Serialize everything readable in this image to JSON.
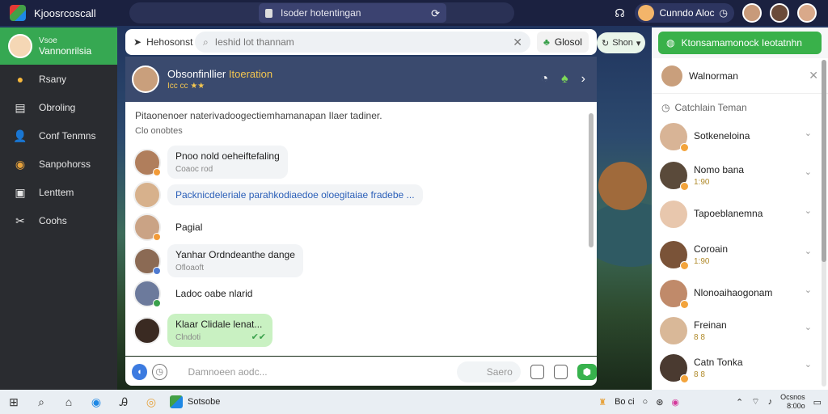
{
  "app": {
    "title": "Kjoosrcoscall"
  },
  "topbar": {
    "address": "Isoder hotentingan",
    "user_name": "Cunndo Aloc"
  },
  "sidebar": {
    "profile_small": "Vsoe",
    "profile_name": "Vannonrilsia",
    "items": [
      {
        "label": "Rsany",
        "icon": "sun-icon"
      },
      {
        "label": "Obroling",
        "icon": "list-icon"
      },
      {
        "label": "Conf Tenmns",
        "icon": "person-icon"
      },
      {
        "label": "Sanpohorss",
        "icon": "chrome-icon"
      },
      {
        "label": "Lenttem",
        "icon": "window-icon"
      },
      {
        "label": "Coohs",
        "icon": "tools-icon"
      }
    ]
  },
  "main_top": {
    "contact": "Hehosonst",
    "search_placeholder": "Ieshid lot thannam",
    "action": "Glosol",
    "filter": "Shon"
  },
  "chat_header": {
    "title_a": "Obsonfinllier",
    "title_b": "Itoeration",
    "subtitle": "Icc cc"
  },
  "chat": {
    "notice": "Pitaonenoer naterivadoogectiemhamanapan Ilaer tadiner.",
    "notice_sub": "Clo onobtes",
    "messages": [
      {
        "text": "Pnoo nold oeheiftefaling",
        "time": "Coaoc rod"
      },
      {
        "text": "Packnicdeleriale parahkodiaedoe oloegitaiae fradebe ..."
      },
      {
        "text": "Pagial"
      },
      {
        "text": "Yanhar Ordndeanthe dange",
        "time": "Ofloaoft"
      },
      {
        "text": "Ladoc oabe nlarid"
      },
      {
        "text": "Klaar Clidale lenat...",
        "time": "Clndoti"
      }
    ]
  },
  "composer": {
    "placeholder": "Damnoeen aodc...",
    "send_hint": "Saero"
  },
  "right_panel": {
    "cta": "Ktonsamamonock Ieotatnhn",
    "header_name": "Walnorman",
    "section": "Catchlain Teman",
    "friends": [
      {
        "name": "Sotkeneloina",
        "sub": ""
      },
      {
        "name": "Nomo bana",
        "sub": "1:90"
      },
      {
        "name": "Tapoeblanemna",
        "sub": ""
      },
      {
        "name": "Coroain",
        "sub": "1:90"
      },
      {
        "name": "Nlonoaihaogonam",
        "sub": ""
      },
      {
        "name": "Freinan",
        "sub": "8 8"
      },
      {
        "name": "Catn Tonka",
        "sub": "8 8"
      }
    ]
  },
  "taskbar": {
    "app_label": "Sotsobe",
    "label_b": "Bo ci",
    "clock_top": "Ocsnos",
    "clock_bottom": "8:00o"
  },
  "colors": {
    "accent_green": "#36a852",
    "topbar": "#1b2140",
    "sidebar": "#2a2c30",
    "link_blue": "#2b5fb8"
  }
}
